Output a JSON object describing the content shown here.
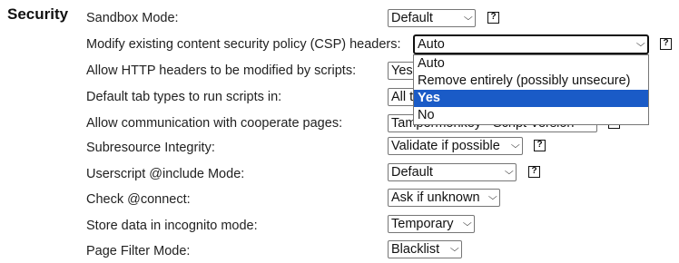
{
  "section": {
    "title": "Security"
  },
  "rows": [
    {
      "label": "Sandbox Mode:",
      "value": "Default"
    },
    {
      "label": "Modify existing content security policy (CSP) headers:",
      "value": "Auto"
    },
    {
      "label": "Allow HTTP headers to be modified by scripts:",
      "value": "Yes"
    },
    {
      "label": "Default tab types to run scripts in:",
      "value": "All t"
    },
    {
      "label": "Allow communication with cooperate pages:",
      "value": "Tampermonkey - Script Version"
    },
    {
      "label": "Subresource Integrity:",
      "value": "Validate if possible"
    },
    {
      "label": "Userscript @include Mode:",
      "value": "Default"
    },
    {
      "label": "Check @connect:",
      "value": "Ask if unknown"
    },
    {
      "label": "Store data in incognito mode:",
      "value": "Temporary"
    },
    {
      "label": "Page Filter Mode:",
      "value": "Blacklist"
    }
  ],
  "csp_dropdown": {
    "options": [
      "Auto",
      "Remove entirely (possibly unsecure)",
      "Yes",
      "No"
    ],
    "highlighted": "Yes"
  },
  "colors": {
    "highlight": "#1a5bc7"
  },
  "icons": {
    "help": "question-help-icon",
    "dropdown": "chevron-down-icon"
  }
}
